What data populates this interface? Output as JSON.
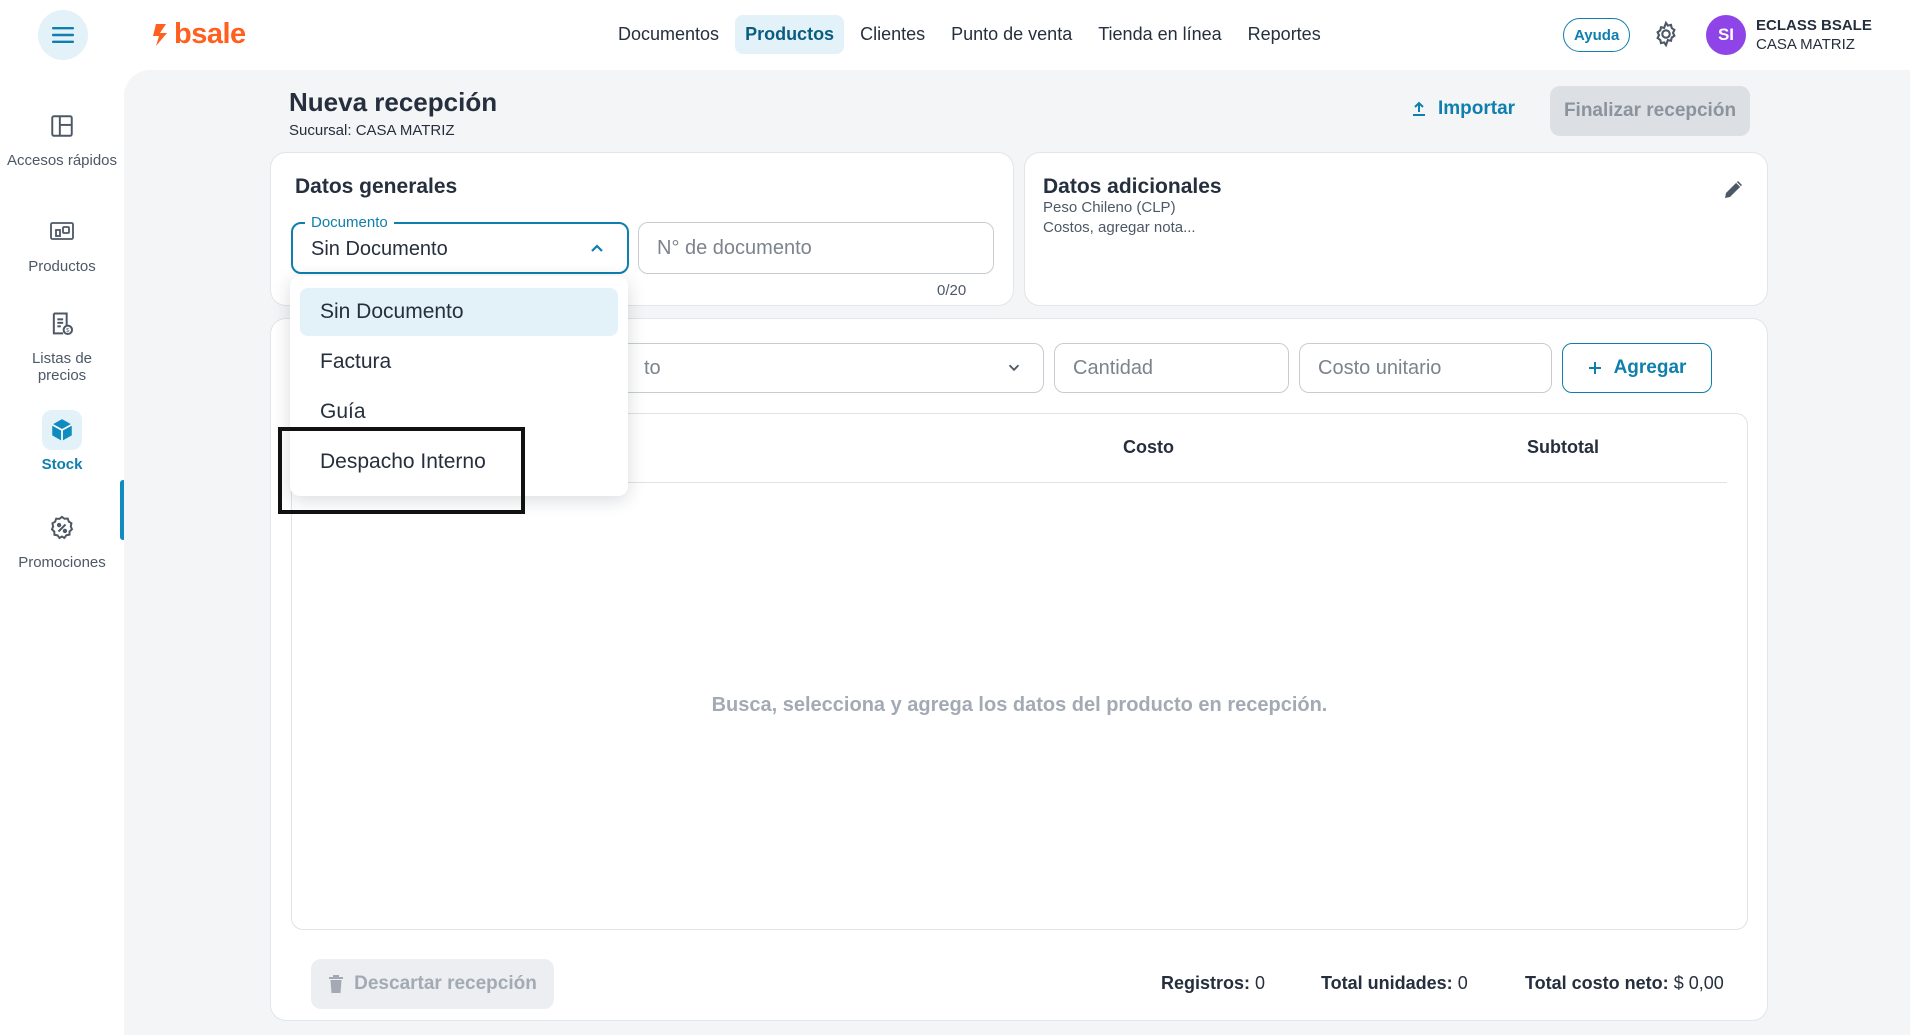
{
  "header": {
    "logo_text": "bsale",
    "nav": [
      {
        "label": "Documentos",
        "active": false
      },
      {
        "label": "Productos",
        "active": true
      },
      {
        "label": "Clientes",
        "active": false
      },
      {
        "label": "Punto de venta",
        "active": false
      },
      {
        "label": "Tienda en línea",
        "active": false
      },
      {
        "label": "Reportes",
        "active": false
      }
    ],
    "help_label": "Ayuda",
    "avatar_initials": "SI",
    "user_name": "ECLASS BSALE",
    "user_branch": "CASA MATRIZ"
  },
  "sidebar": {
    "items": [
      {
        "label": "Accesos rápidos",
        "icon": "layout-icon",
        "active": false
      },
      {
        "label": "Productos",
        "icon": "products-icon",
        "active": false
      },
      {
        "label": "Listas de precios",
        "icon": "price-list-icon",
        "active": false
      },
      {
        "label": "Stock",
        "icon": "stock-box-icon",
        "active": true
      },
      {
        "label": "Promociones",
        "icon": "promo-icon",
        "active": false
      }
    ]
  },
  "page": {
    "title": "Nueva recepción",
    "subtitle": "Sucursal: CASA MATRIZ",
    "import_label": "Importar",
    "finish_label": "Finalizar recepción"
  },
  "general": {
    "title": "Datos generales",
    "document_label": "Documento",
    "document_value": "Sin Documento",
    "doc_number_placeholder": "N° de documento",
    "doc_number_counter": "0/20"
  },
  "additional": {
    "title": "Datos adicionales",
    "line1": "Peso Chileno (CLP)",
    "line2": "Costos, agregar nota..."
  },
  "products": {
    "product_placeholder_fragment": "to",
    "quantity_placeholder": "Cantidad",
    "unit_cost_placeholder": "Costo unitario",
    "add_label": "Agregar",
    "columns": {
      "cost": "Costo",
      "subtotal": "Subtotal"
    },
    "empty_message": "Busca, selecciona y agrega los datos del producto en recepción.",
    "discard_label": "Descartar recepción",
    "summary": {
      "records_label": "Registros:",
      "records_value": "0",
      "units_label": "Total unidades:",
      "units_value": "0",
      "net_cost_label": "Total costo neto:",
      "net_cost_value": "$ 0,00"
    }
  },
  "dropdown": {
    "options": [
      {
        "label": "Sin Documento",
        "selected": true
      },
      {
        "label": "Factura",
        "selected": false
      },
      {
        "label": "Guía",
        "selected": false
      },
      {
        "label": "Despacho Interno",
        "selected": false
      }
    ]
  },
  "colors": {
    "accent": "#0f7fad",
    "brand_orange": "#ff5f1f",
    "avatar": "#8e44e6"
  }
}
